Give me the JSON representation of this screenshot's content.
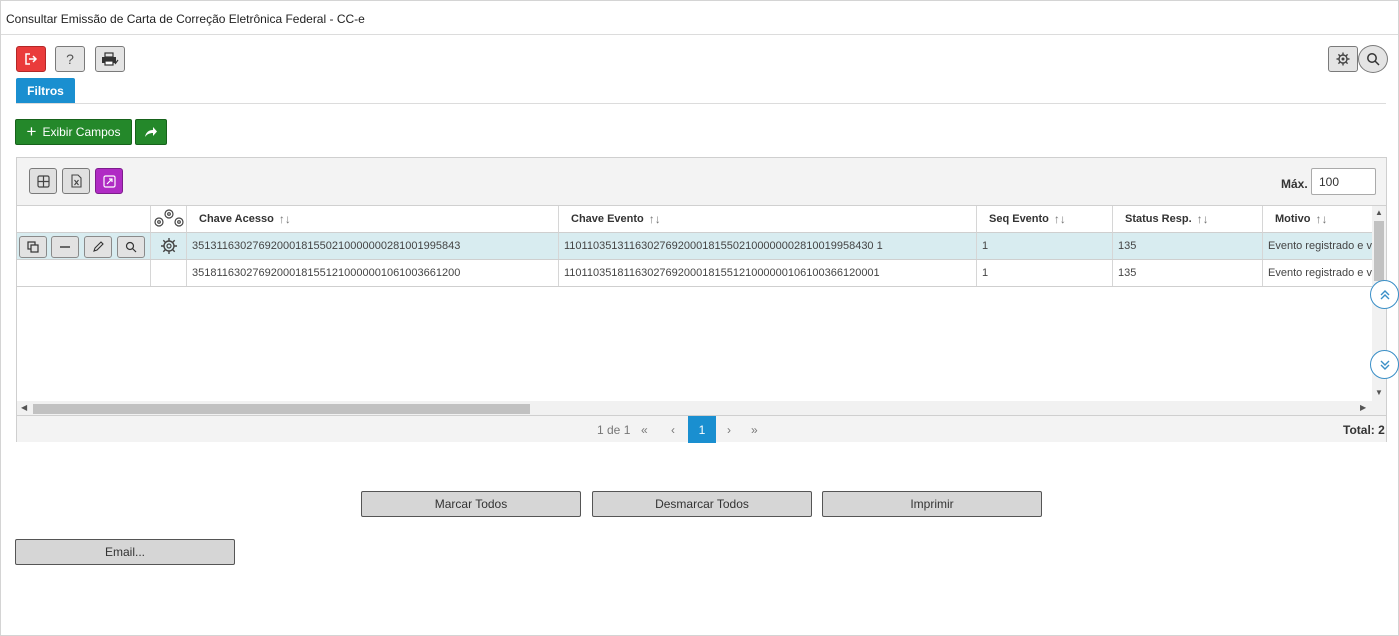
{
  "window": {
    "title": "Consultar Emissão de Carta de Correção Eletrônica Federal - CC-e"
  },
  "toolbar": {
    "exit_icon": "exit-icon",
    "help_label": "?",
    "print_icon": "printer-icon",
    "settings_icon": "gear-icon",
    "search_icon": "search-icon"
  },
  "tabs": {
    "filtros": "Filtros"
  },
  "actions": {
    "exibir_campos": "Exibir Campos",
    "share_icon": "share-arrow-icon"
  },
  "grid": {
    "max_label": "Máx.",
    "max_value": "100",
    "columns": [
      "Chave Acesso",
      "Chave Evento",
      "Seq Evento",
      "Status Resp.",
      "Motivo"
    ],
    "sort_glyph": "↑↓",
    "rows": [
      {
        "chave_acesso": "35131163027692000181550210000000281001995843",
        "chave_evento": "110110351311630276920001815502100000002810019958430 1",
        "seq_evento": "1",
        "status_resp": "135",
        "motivo": "Evento registrado e vinculado a NF-e"
      },
      {
        "chave_acesso": "35181163027692000181551210000001061003661200",
        "chave_evento": "1101103518116302769200018155121000000106100366120001",
        "seq_evento": "1",
        "status_resp": "135",
        "motivo": "Evento registrado e vinculado a NF-e"
      }
    ],
    "pager": {
      "page_info": "1 de 1",
      "first": "«",
      "prev": "‹",
      "current": "1",
      "next": "›",
      "last": "»",
      "total": "Total: 2"
    }
  },
  "bottom_buttons": {
    "marcar_todos": "Marcar Todos",
    "desmarcar_todos": "Desmarcar Todos",
    "imprimir": "Imprimir",
    "email": "Email..."
  }
}
